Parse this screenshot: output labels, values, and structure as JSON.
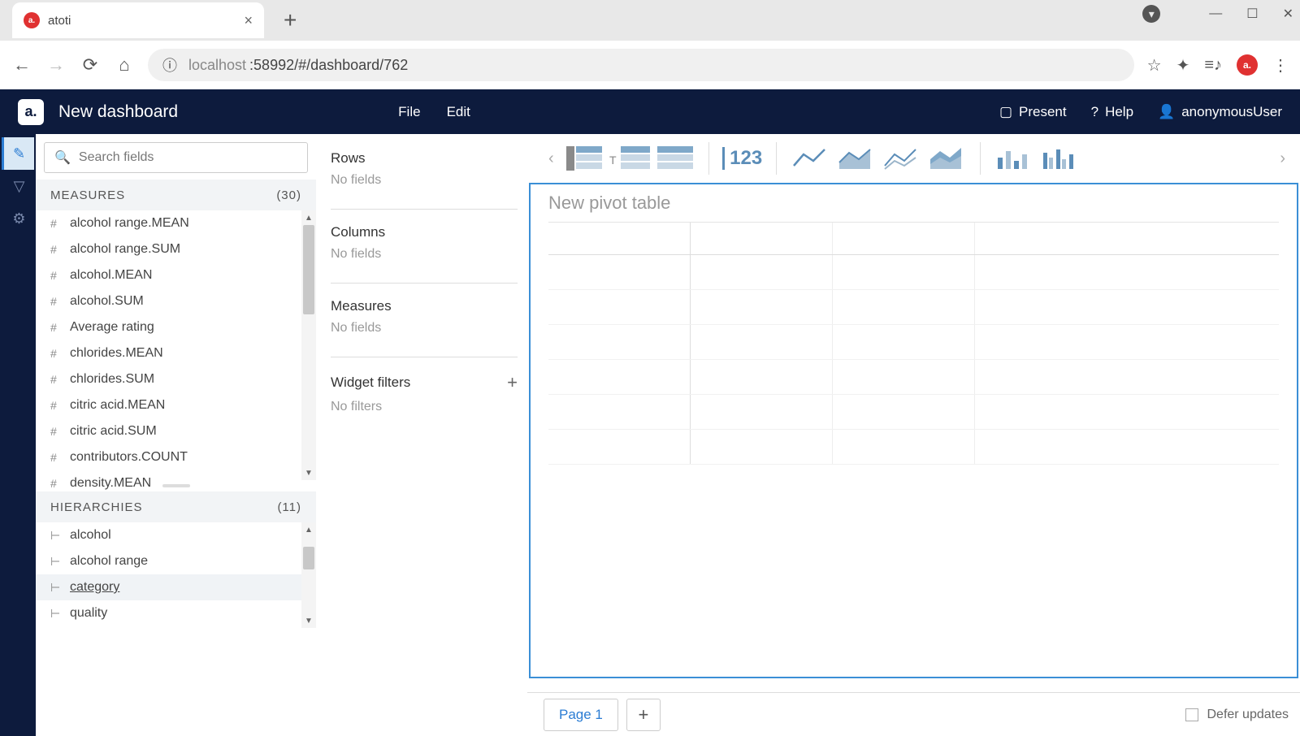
{
  "browser": {
    "tab_title": "atoti",
    "url_host": "localhost",
    "url_path": ":58992/#/dashboard/762"
  },
  "app": {
    "title": "New dashboard",
    "menu": {
      "file": "File",
      "edit": "Edit"
    },
    "right": {
      "present": "Present",
      "help": "Help",
      "user": "anonymousUser"
    }
  },
  "search": {
    "placeholder": "Search fields"
  },
  "measures": {
    "label": "MEASURES",
    "count": "(30)",
    "items": [
      "alcohol range.MEAN",
      "alcohol range.SUM",
      "alcohol.MEAN",
      "alcohol.SUM",
      "Average rating",
      "chlorides.MEAN",
      "chlorides.SUM",
      "citric acid.MEAN",
      "citric acid.SUM",
      "contributors.COUNT",
      "density.MEAN"
    ]
  },
  "hierarchies": {
    "label": "HIERARCHIES",
    "count": "(11)",
    "items": [
      "alcohol",
      "alcohol range",
      "category",
      "quality"
    ]
  },
  "dropzones": {
    "rows": {
      "title": "Rows",
      "empty": "No fields"
    },
    "columns": {
      "title": "Columns",
      "empty": "No fields"
    },
    "measures": {
      "title": "Measures",
      "empty": "No fields"
    },
    "filters": {
      "title": "Widget filters",
      "empty": "No filters"
    }
  },
  "pivot": {
    "title": "New pivot table"
  },
  "pages": {
    "page1": "Page 1"
  },
  "footer": {
    "defer": "Defer updates"
  },
  "toolbar": {
    "number_label": "123"
  }
}
